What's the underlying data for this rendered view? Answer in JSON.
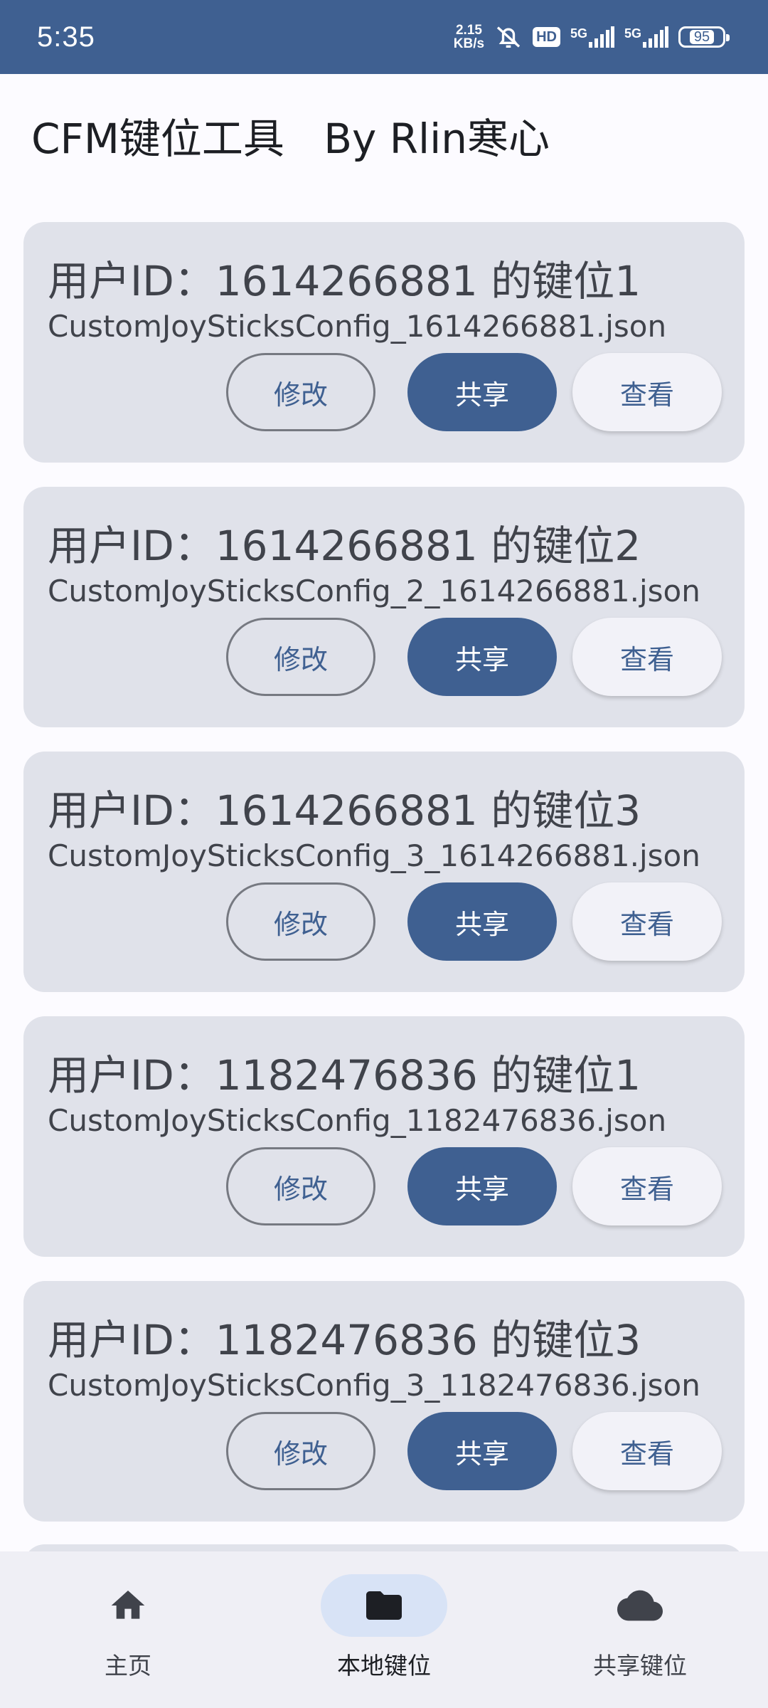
{
  "status_bar": {
    "time": "5:35",
    "net_speed_value": "2.15",
    "net_speed_unit": "KB/s",
    "hd_label": "HD",
    "signal1_label": "5G",
    "signal2_label": "5G",
    "battery_level": "95"
  },
  "app_bar": {
    "title": "CFM键位工具   By Rlin寒心"
  },
  "cards": [
    {
      "title": "用户ID：1614266881 的键位1",
      "file": "CustomJoySticksConfig_1614266881.json",
      "edit_label": "修改",
      "share_label": "共享",
      "view_label": "查看"
    },
    {
      "title": "用户ID：1614266881 的键位2",
      "file": "CustomJoySticksConfig_2_1614266881.json",
      "edit_label": "修改",
      "share_label": "共享",
      "view_label": "查看"
    },
    {
      "title": "用户ID：1614266881 的键位3",
      "file": "CustomJoySticksConfig_3_1614266881.json",
      "edit_label": "修改",
      "share_label": "共享",
      "view_label": "查看"
    },
    {
      "title": "用户ID：1182476836 的键位1",
      "file": "CustomJoySticksConfig_1182476836.json",
      "edit_label": "修改",
      "share_label": "共享",
      "view_label": "查看"
    },
    {
      "title": "用户ID：1182476836 的键位3",
      "file": "CustomJoySticksConfig_3_1182476836.json",
      "edit_label": "修改",
      "share_label": "共享",
      "view_label": "查看"
    }
  ],
  "bottom_nav": {
    "items": [
      {
        "label": "主页",
        "icon": "home-icon",
        "active": false
      },
      {
        "label": "本地键位",
        "icon": "folder-icon",
        "active": true
      },
      {
        "label": "共享键位",
        "icon": "cloud-icon",
        "active": false
      }
    ]
  },
  "colors": {
    "primary": "#3f6091",
    "card_bg": "#e0e2ea",
    "active_indicator": "#d8e3f6"
  }
}
